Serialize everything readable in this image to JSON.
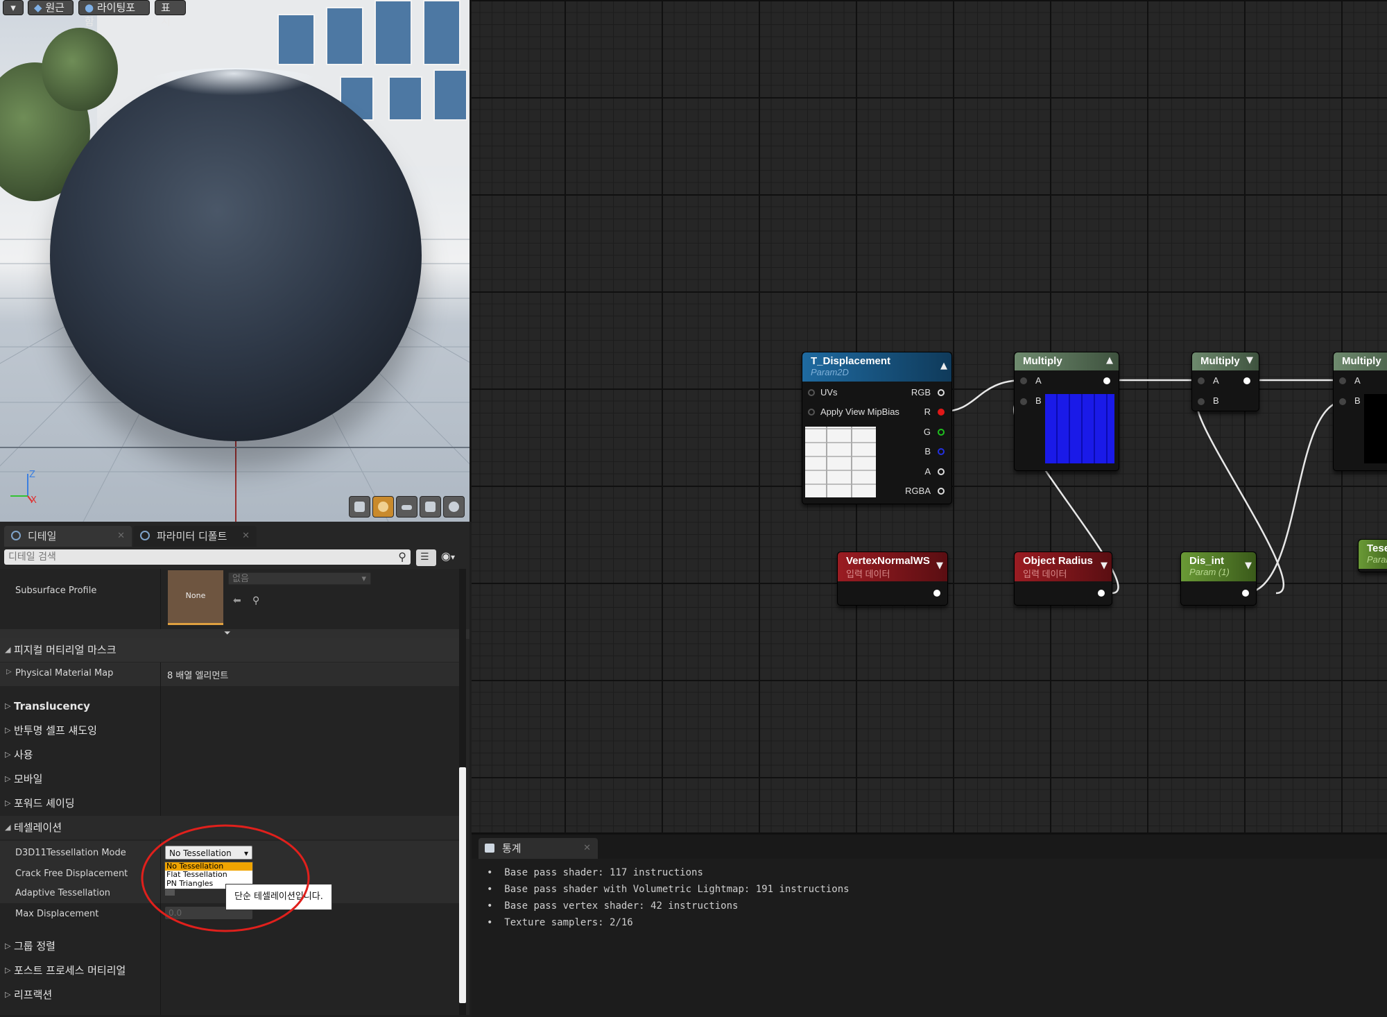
{
  "viewport": {
    "buttons": [
      "원근",
      "라이팅포함",
      "표시"
    ],
    "axis_labels": {
      "z": "Z",
      "x": "X"
    }
  },
  "details": {
    "tabs": [
      {
        "label": "디테일",
        "icon": "magnifier-icon"
      },
      {
        "label": "파라미터 디폴트",
        "icon": "magnifier-icon"
      }
    ],
    "search_placeholder": "디테일 검색",
    "subsurface_profile": {
      "label": "Subsurface Profile",
      "thumbnail": "None",
      "value": "없음"
    },
    "physical_mask_category": "피지컬 머티리얼 마스크",
    "physical_material_map": {
      "label": "Physical Material Map",
      "value": "8 배열 엘리먼트"
    },
    "categories_a": [
      "Translucency",
      "반투명 셀프 섀도잉",
      "사용",
      "모바일",
      "포워드 셰이딩"
    ],
    "tessellation_category": "테셀레이션",
    "tessellation_rows": {
      "mode": "D3D11Tessellation Mode",
      "crack": "Crack Free Displacement",
      "adaptive": "Adaptive Tessellation",
      "max": "Max Displacement"
    },
    "mode_value": "No Tessellation",
    "dropdown_options": [
      "No Tessellation",
      "Flat Tessellation",
      "PN Triangles"
    ],
    "max_value": "0.0",
    "tooltip": "단순 테셀레이션입니다.",
    "categories_b": [
      "그룹 정렬",
      "포스트 프로세스 머티리얼",
      "리프랙션"
    ]
  },
  "graph": {
    "t_displacement": {
      "title": "T_Displacement",
      "subtitle": "Param2D",
      "inputs": [
        "UVs",
        "Apply View MipBias"
      ],
      "outputs": [
        "RGB",
        "R",
        "G",
        "B",
        "A",
        "RGBA"
      ]
    },
    "multiply1": {
      "title": "Multiply",
      "a": "A",
      "b": "B"
    },
    "multiply2": {
      "title": "Multiply",
      "a": "A",
      "b": "B"
    },
    "multiply3": {
      "title": "Multiply",
      "a": "A",
      "b": "B"
    },
    "vertex_normal": {
      "title": "VertexNormalWS",
      "subtitle": "입력 데이터"
    },
    "object_radius": {
      "title": "Object Radius",
      "subtitle": "입력 데이터"
    },
    "dis_int": {
      "title": "Dis_int",
      "subtitle": "Param (1)"
    },
    "tess_partial": {
      "title": "Tese",
      "subtitle": "Param"
    }
  },
  "stats": {
    "tab": "통계",
    "lines": [
      "Base pass shader: 117 instructions",
      "Base pass shader with Volumetric Lightmap: 191 instructions",
      "Base pass vertex shader: 42 instructions",
      "Texture samplers: 2/16"
    ]
  },
  "colors": {
    "accent": "#c98a2c",
    "selection": "#f0a400",
    "annotation": "#e0201c",
    "texture_node": "#1f6aa0",
    "input_node": "#9a1c22",
    "param_node": "#6a9a36"
  }
}
